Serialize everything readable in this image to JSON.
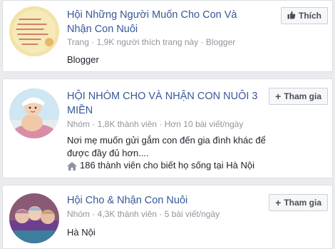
{
  "results": [
    {
      "title": "Hội Những Người Muốn Cho Con Và Nhận Con Nuôi",
      "meta": "Trang · 1,9K người thích trang này · Blogger",
      "description": "Blogger",
      "extra": "",
      "button_label": "Thích",
      "button_icon": "thumbs-up-icon"
    },
    {
      "title": "HỘI NHÓM CHO VÀ NHẬN CON NUÔI 3 MIỀN",
      "meta": "Nhóm · 1,8K thành viên · Hơn 10 bài viết/ngày",
      "description": "Nơi mẹ muốn gửi gắm con đến gia đình khác để được đầy đủ hơn....",
      "extra": "186 thành viên cho biết họ sống tại Hà Nội",
      "extra_icon": "home-icon",
      "button_label": "Tham gia",
      "button_icon": "plus-icon"
    },
    {
      "title": "Hội Cho & Nhận Con Nuôi",
      "meta": "Nhóm · 4,3K thành viên · 5 bài viết/ngày",
      "description": "Hà Nội",
      "extra": "",
      "button_label": "Tham gia",
      "button_icon": "plus-icon"
    }
  ],
  "colors": {
    "link": "#365899",
    "meta": "#90949c",
    "text": "#1d2129",
    "background": "#e9ebee"
  }
}
